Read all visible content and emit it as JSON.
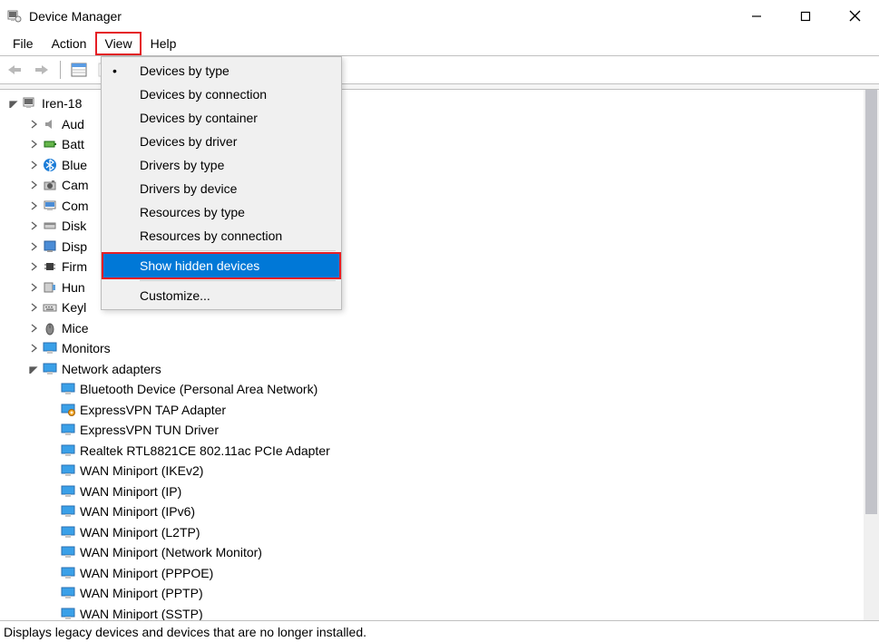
{
  "window": {
    "title": "Device Manager"
  },
  "menubar": {
    "file": "File",
    "action": "Action",
    "view": "View",
    "help": "Help"
  },
  "view_menu": {
    "dot_marker": "•",
    "items": [
      "Devices by type",
      "Devices by connection",
      "Devices by container",
      "Devices by driver",
      "Drivers by type",
      "Drivers by device",
      "Resources by type",
      "Resources by connection"
    ],
    "show_hidden": "Show hidden devices",
    "customize": "Customize..."
  },
  "tree": {
    "root": "Iren-18",
    "categories": [
      "Aud",
      "Batt",
      "Blue",
      "Cam",
      "Com",
      "Disk",
      "Disp",
      "Firm",
      "Hun",
      "Keyl",
      "Mice",
      "Monitors",
      "Network adapters"
    ],
    "network_children": [
      "Bluetooth Device (Personal Area Network)",
      "ExpressVPN TAP Adapter",
      "ExpressVPN TUN Driver",
      "Realtek RTL8821CE 802.11ac PCIe Adapter",
      "WAN Miniport (IKEv2)",
      "WAN Miniport (IP)",
      "WAN Miniport (IPv6)",
      "WAN Miniport (L2TP)",
      "WAN Miniport (Network Monitor)",
      "WAN Miniport (PPPOE)",
      "WAN Miniport (PPTP)",
      "WAN Miniport (SSTP)"
    ]
  },
  "statusbar": {
    "text": "Displays legacy devices and devices that are no longer installed."
  }
}
